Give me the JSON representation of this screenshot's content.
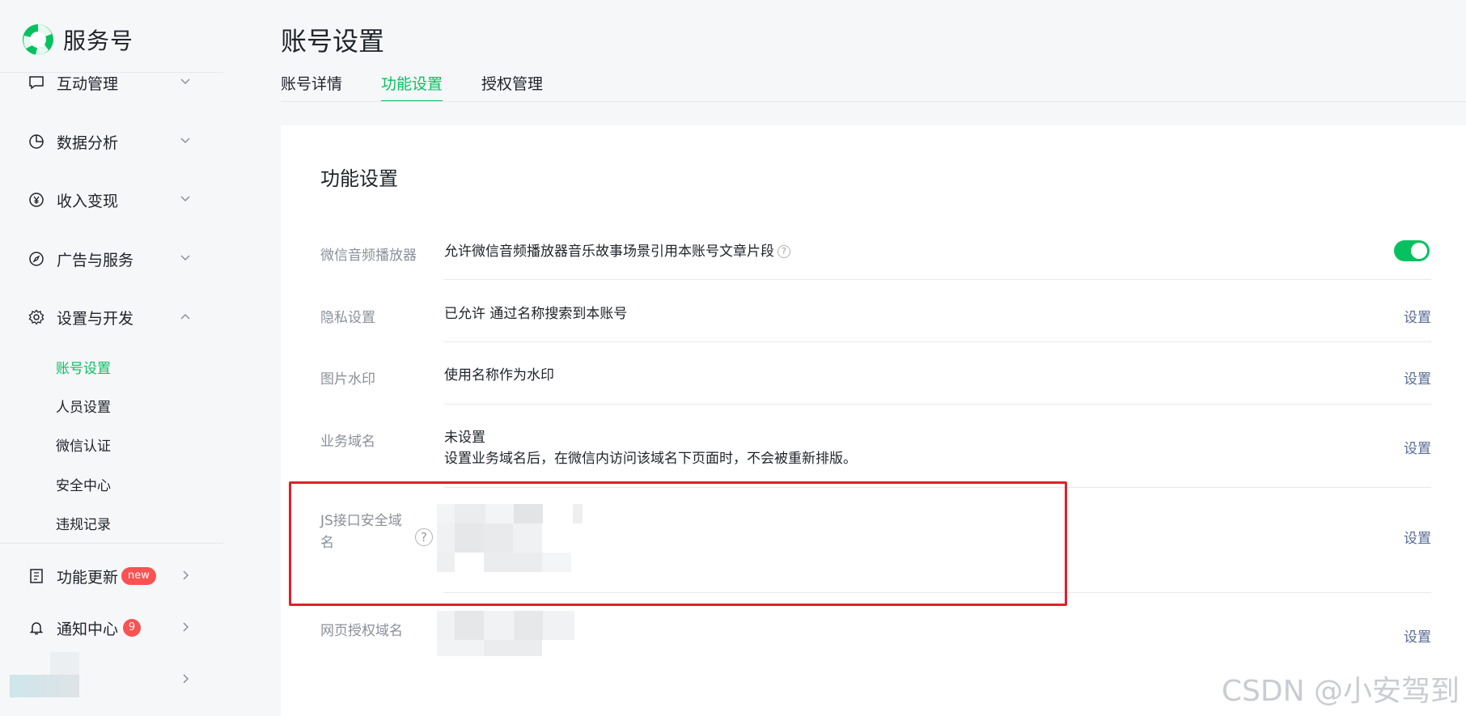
{
  "app": {
    "name": "服务号"
  },
  "sidebar": {
    "items": [
      {
        "label": "互动管理",
        "icon": "chat-icon",
        "expanded": false
      },
      {
        "label": "数据分析",
        "icon": "pie-chart-icon",
        "expanded": false
      },
      {
        "label": "收入变现",
        "icon": "yen-icon",
        "expanded": false
      },
      {
        "label": "广告与服务",
        "icon": "compass-icon",
        "expanded": false
      },
      {
        "label": "设置与开发",
        "icon": "gear-icon",
        "expanded": true
      }
    ],
    "sub_items": [
      {
        "label": "账号设置",
        "active": true
      },
      {
        "label": "人员设置",
        "active": false
      },
      {
        "label": "微信认证",
        "active": false
      },
      {
        "label": "安全中心",
        "active": false
      },
      {
        "label": "违规记录",
        "active": false
      }
    ],
    "bottom": [
      {
        "label": "功能更新",
        "icon": "book-icon",
        "badge": "new"
      },
      {
        "label": "通知中心",
        "icon": "bell-icon",
        "badge": "9"
      }
    ]
  },
  "header": {
    "title": "账号设置"
  },
  "tabs": [
    {
      "label": "账号详情",
      "active": false
    },
    {
      "label": "功能设置",
      "active": true
    },
    {
      "label": "授权管理",
      "active": false
    }
  ],
  "card": {
    "title": "功能设置",
    "rows": [
      {
        "label": "微信音频播放器",
        "value": "允许微信音频播放器音乐故事场景引用本账号文章片段",
        "control": "toggle",
        "toggle_on": true
      },
      {
        "label": "隐私设置",
        "value": "已允许 通过名称搜索到本账号",
        "action": "设置"
      },
      {
        "label": "图片水印",
        "value": "使用名称作为水印",
        "action": "设置"
      },
      {
        "label": "业务域名",
        "value": "未设置",
        "value2": "设置业务域名后，在微信内访问该域名下页面时，不会被重新排版。",
        "action": "设置"
      },
      {
        "label": "JS接口安全域名",
        "help": "?",
        "action": "设置"
      },
      {
        "label": "网页授权域名",
        "action": "设置"
      }
    ]
  },
  "watermark": "CSDN @小安驾到",
  "colors": {
    "accent": "#07c160",
    "link": "#576b95",
    "badge": "#fa5151",
    "highlight": "#e0202a"
  }
}
